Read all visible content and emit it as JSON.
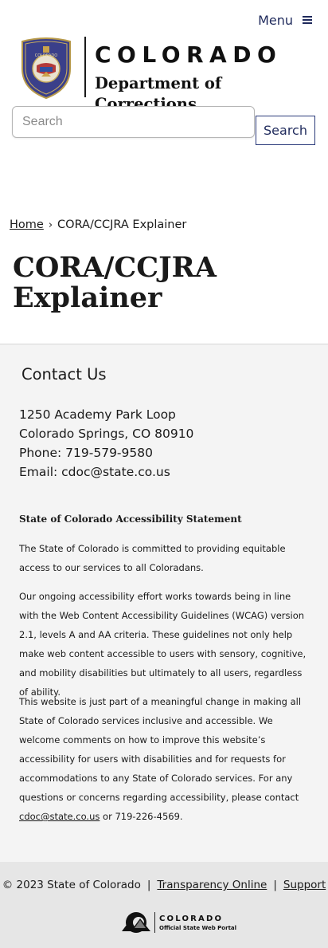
{
  "header": {
    "menu_label": "Menu",
    "logo_state": "COLORADO",
    "logo_department": "Department of Corrections",
    "seal_text": "COLORADO DEPARTMENT OF CORRECTIONS"
  },
  "search": {
    "placeholder": "Search",
    "button_label": "Search"
  },
  "breadcrumb": {
    "home": "Home",
    "current": "CORA/CCJRA Explainer"
  },
  "page": {
    "title": "CORA/CCJRA Explainer"
  },
  "contact": {
    "heading": "Contact Us",
    "address_line1": "1250 Academy Park Loop",
    "address_line2": "Colorado Springs, CO 80910",
    "phone": "Phone: 719-579-9580",
    "email_label": "Email: ",
    "email": "cdoc@state.co.us"
  },
  "accessibility": {
    "heading": "State of Colorado Accessibility Statement",
    "para1": "The State of Colorado is committed to providing equitable access to our services to all Coloradans.",
    "para2": "Our ongoing accessibility effort works towards being in line with the Web Content Accessibility Guidelines (WCAG) version 2.1, levels A and AA criteria. These guidelines not only help make web content accessible to users with sensory, cognitive, and mobility disabilities but ultimately to all users, regardless of ability.",
    "para3_start": "This website is just part of a meaningful change in making all State of Colorado services inclusive and accessible. We welcome comments on how to improve this website’s accessibility for users with disabilities and for requests for accommodations to any State of Colorado services. For any questions or concerns regarding accessibility, please contact ",
    "para3_email": "cdoc@state.co.us",
    "para3_end": " or 719-226-4569."
  },
  "footer": {
    "copyright": "© 2023 State of Colorado",
    "separator": "|",
    "transparency_link": "Transparency Online",
    "support_link": "Support",
    "portal_name": "COLORADO",
    "portal_sub": "Official State Web Portal"
  },
  "colors": {
    "accent": "#1f2a5c",
    "footer_bg": "#f4f4f4",
    "footer_bottom_bg": "#e6e6e6"
  },
  "icons": [
    "hamburger-menu-icon",
    "chevron-right-icon",
    "department-seal",
    "colorado-portal-logo"
  ]
}
